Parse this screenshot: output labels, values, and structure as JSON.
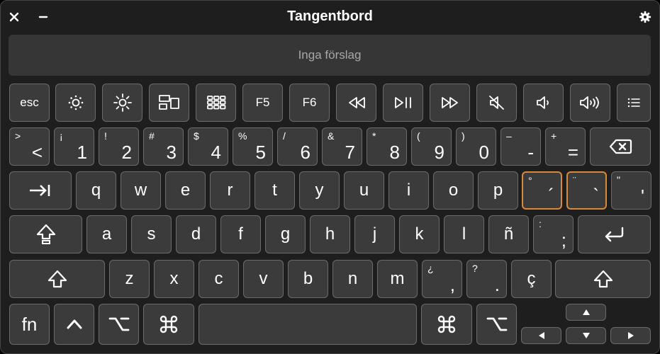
{
  "window": {
    "title": "Tangentbord",
    "close_icon": "close-icon",
    "minimize_icon": "minimize-icon",
    "settings_icon": "gear-icon"
  },
  "suggestions": {
    "text": "Inga förslag"
  },
  "colors": {
    "background": "#1e1e1e",
    "key": "#3b3b3b",
    "highlight": "#d8893a",
    "text": "#ffffff"
  },
  "rows": {
    "function": [
      "esc",
      "brightness-down-icon",
      "brightness-up-icon",
      "mission-control-icon",
      "launchpad-icon",
      "F5",
      "F6",
      "rewind-icon",
      "play-pause-icon",
      "fast-forward-icon",
      "mute-icon",
      "volume-down-icon",
      "volume-up-icon",
      "list-icon"
    ],
    "numbers": [
      {
        "sec": ">",
        "main": "<"
      },
      {
        "sec": "¡",
        "main": "1"
      },
      {
        "sec": "!",
        "main": "2"
      },
      {
        "sec": "#",
        "main": "3"
      },
      {
        "sec": "$",
        "main": "4"
      },
      {
        "sec": "%",
        "main": "5"
      },
      {
        "sec": "/",
        "main": "6"
      },
      {
        "sec": "&",
        "main": "7"
      },
      {
        "sec": "*",
        "main": "8"
      },
      {
        "sec": "(",
        "main": "9"
      },
      {
        "sec": ")",
        "main": "0"
      },
      {
        "sec": "–",
        "main": "-"
      },
      {
        "sec": "+",
        "main": "="
      }
    ],
    "qwerty": [
      "q",
      "w",
      "e",
      "r",
      "t",
      "y",
      "u",
      "i",
      "o",
      "p"
    ],
    "qwerty_extra": [
      {
        "sec": "°",
        "main": "´"
      },
      {
        "sec": "¨",
        "main": "`"
      },
      {
        "sec": "\"",
        "main": "'"
      }
    ],
    "home": [
      "a",
      "s",
      "d",
      "f",
      "g",
      "h",
      "j",
      "k",
      "l",
      "ñ"
    ],
    "home_extra": {
      "sec": ":",
      "main": ";"
    },
    "bottom": [
      "z",
      "x",
      "c",
      "v",
      "b",
      "n",
      "m"
    ],
    "bottom_extra": [
      {
        "sec": "¿",
        "main": ","
      },
      {
        "sec": "?",
        "main": "."
      },
      {
        "sec": "",
        "main": "ç"
      }
    ],
    "modifiers": {
      "fn": "fn",
      "control": "^",
      "option": "⌥",
      "command": "⌘"
    }
  }
}
